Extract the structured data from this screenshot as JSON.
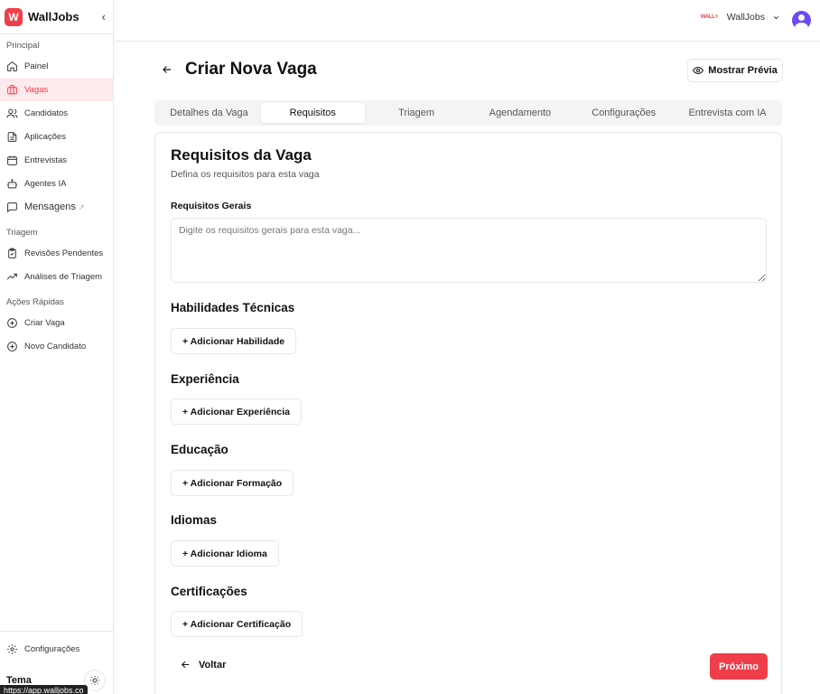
{
  "brand": {
    "name": "WallJobs",
    "logo_letter": "W",
    "accent_color": "#ef3e4a"
  },
  "sidebar": {
    "sections": [
      {
        "label": "Principal",
        "items": [
          {
            "label": "Painel",
            "icon": "home-icon"
          },
          {
            "label": "Vagas",
            "icon": "briefcase-icon",
            "active": true
          },
          {
            "label": "Candidatos",
            "icon": "users-icon"
          },
          {
            "label": "Aplicações",
            "icon": "file-icon"
          },
          {
            "label": "Entrevistas",
            "icon": "calendar-icon"
          },
          {
            "label": "Agentes IA",
            "icon": "bot-icon"
          },
          {
            "label": "Mensagens",
            "icon": "message-icon",
            "external_icon": "external-link-icon"
          }
        ]
      },
      {
        "label": "Triagem",
        "items": [
          {
            "label": "Revisões Pendentes",
            "icon": "clipboard-check-icon"
          },
          {
            "label": "Análises de Triagem",
            "icon": "trending-up-icon"
          }
        ]
      },
      {
        "label": "Ações Rápidas",
        "items": [
          {
            "label": "Criar Vaga",
            "icon": "plus-circle-icon"
          },
          {
            "label": "Novo Candidato",
            "icon": "plus-circle-icon"
          }
        ]
      }
    ],
    "settings_label": "Configurações",
    "theme_label": "Tema",
    "status_url": "https://app.walljobs.co"
  },
  "topbar": {
    "tenant_logo": "WALL+",
    "tenant_name": "WallJobs"
  },
  "page": {
    "title": "Criar Nova Vaga",
    "preview_button": "Mostrar Prévia",
    "tabs": [
      {
        "label": "Detalhes da Vaga"
      },
      {
        "label": "Requisitos",
        "active": true
      },
      {
        "label": "Triagem"
      },
      {
        "label": "Agendamento"
      },
      {
        "label": "Configurações"
      },
      {
        "label": "Entrevista com IA"
      }
    ]
  },
  "card": {
    "title": "Requisitos da Vaga",
    "subtitle": "Defina os requisitos para esta vaga",
    "general_label": "Requisitos Gerais",
    "general_value": "",
    "general_placeholder": "Digite os requisitos gerais para esta vaga...",
    "sections": [
      {
        "heading": "Habilidades Técnicas",
        "button": "+ Adicionar Habilidade"
      },
      {
        "heading": "Experiência",
        "button": "+ Adicionar Experiência"
      },
      {
        "heading": "Educação",
        "button": "+ Adicionar Formação"
      },
      {
        "heading": "Idiomas",
        "button": "+ Adicionar Idioma"
      },
      {
        "heading": "Certificações",
        "button": "+ Adicionar Certificação"
      }
    ],
    "back_button": "Voltar",
    "next_button": "Próximo"
  }
}
